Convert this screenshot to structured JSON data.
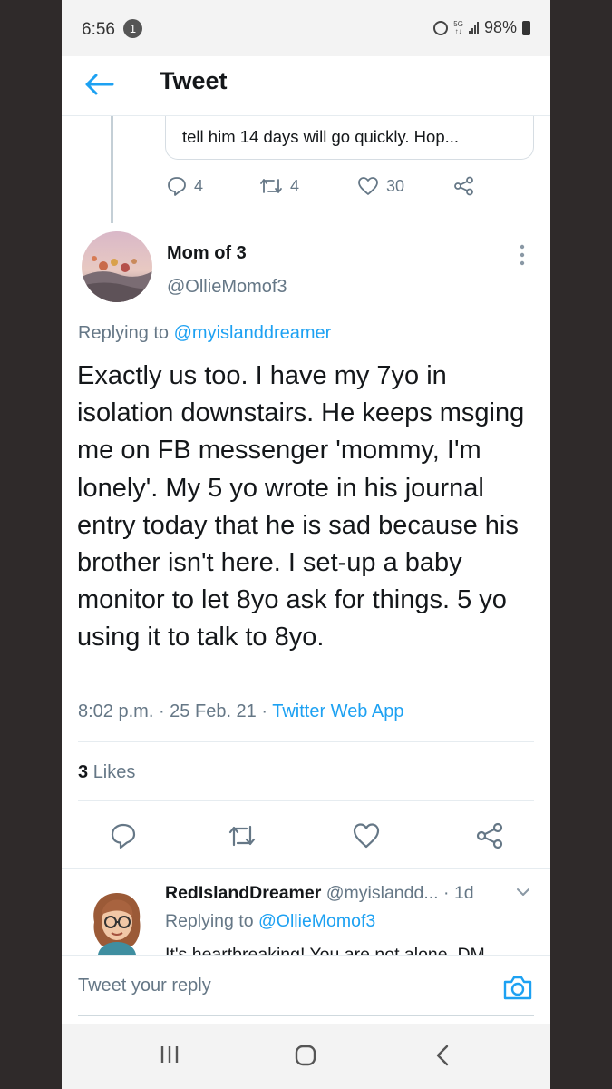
{
  "colors": {
    "accent": "#1da1f2",
    "text": "#14171a",
    "muted": "#657786",
    "frame": "#2f2a2a"
  },
  "status_bar": {
    "time": "6:56",
    "notification_count": "1",
    "network": "5G",
    "battery": "98%"
  },
  "header": {
    "title": "Tweet",
    "back_icon": "arrow-left-icon"
  },
  "previous_tweet": {
    "quoted_text": "tell him 14 days will go quickly. Hop...",
    "replies": "4",
    "retweets": "4",
    "likes": "30"
  },
  "tweet": {
    "author_name": "Mom of 3",
    "author_handle": "@OllieMomof3",
    "replying_prefix": "Replying to",
    "replying_to": "@myislanddreamer",
    "body": "Exactly us too. I have my 7yo in isolation downstairs. He keeps msging me on FB messenger 'mommy, I'm lonely'. My 5 yo wrote in his journal entry today that he is sad because his brother isn't here. I set-up a baby monitor to let 8yo ask for things. 5 yo using it to talk to 8yo.",
    "time": "8:02 p.m.",
    "date": "25 Feb. 21",
    "source": "Twitter Web App",
    "likes_count": "3",
    "likes_label": "Likes"
  },
  "reply": {
    "name": "RedIslandDreamer",
    "handle": "@myislandd...",
    "age": "1d",
    "replying_prefix": "Replying to",
    "replying_to": "@OllieMomof3",
    "text": "It's heartbreaking! You are not alone. DM"
  },
  "composer": {
    "placeholder": "Tweet your reply"
  },
  "navbar": {
    "icons": [
      "recent-apps-icon",
      "home-icon",
      "back-icon"
    ]
  }
}
